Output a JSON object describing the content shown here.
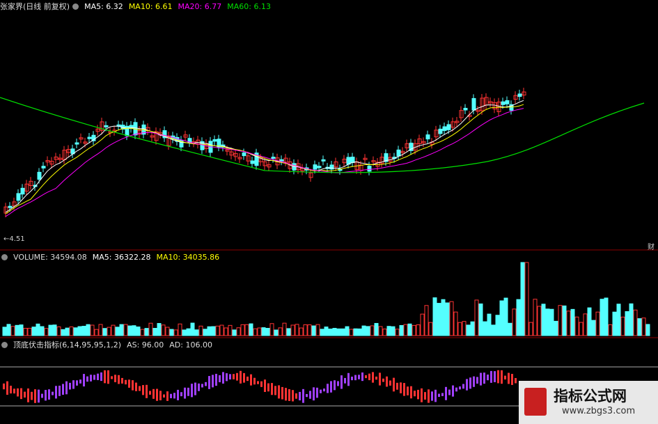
{
  "main_panel": {
    "stock_name": "张家界(日线 前复权)",
    "ma5": "MA5: 6.32",
    "ma10": "MA10: 6.61",
    "ma20": "MA20: 6.77",
    "ma60": "MA60: 6.13",
    "low_marker": "←4.51",
    "right_tag": "财"
  },
  "volume_panel": {
    "label": "VOLUME: 34594.08",
    "ma5": "MA5: 36322.28",
    "ma10": "MA10: 34035.86"
  },
  "indicator_panel": {
    "label": "顶底伏击指标(6,14,95,95,1,2)",
    "as": "AS: 96.00",
    "ad": "AD: 106.00"
  },
  "watermark": {
    "title": "指标公式网",
    "url": "www.zbgs3.com"
  },
  "colors": {
    "up": "#ff3333",
    "down": "#54ffff",
    "ma5": "#ffffff",
    "ma10": "#ffff00",
    "ma20": "#ff00ff",
    "ma60": "#00e000",
    "indicator_down": "#a040ff",
    "separator": "#8b0000"
  }
}
